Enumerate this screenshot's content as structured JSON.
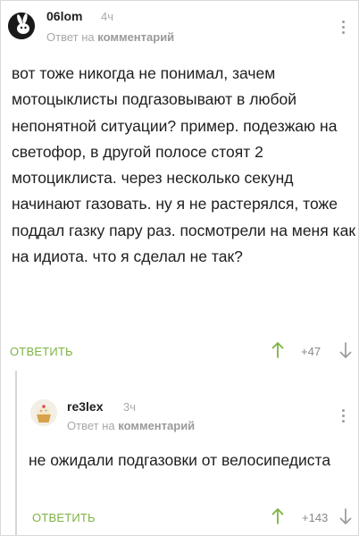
{
  "accent_color": "#7cb342",
  "comments": [
    {
      "username": "06lom",
      "time": "4ч",
      "subline_prefix": "Ответ на",
      "subline_target": "комментарий",
      "text": "вот тоже никогда не понимал, зачем мотоцыклисты подгазовывают в любой непонятной ситуации? пример. подезжаю на светофор, в другой полосе стоят 2 мотоциклиста. через несколько секунд начинают газовать. ну я не растерялся, тоже поддал газку пару раз. посмотрели на меня как на идиота. что я сделал не так?",
      "reply_label": "ОТВЕТИТЬ",
      "rating": "+47",
      "avatar_icon": "rabbit-avatar-icon",
      "upvote_icon": "arrow-up-icon",
      "downvote_icon": "arrow-down-icon",
      "menu_icon": "more-vertical-icon"
    },
    {
      "username": "re3lex",
      "time": "3ч",
      "subline_prefix": "Ответ на",
      "subline_target": "комментарий",
      "text": "не ожидали подгазовки от велосипедиста",
      "reply_label": "ОТВЕТИТЬ",
      "rating": "+143",
      "avatar_icon": "cupcake-avatar-icon",
      "upvote_icon": "arrow-up-icon",
      "downvote_icon": "arrow-down-icon",
      "menu_icon": "more-vertical-icon"
    }
  ]
}
